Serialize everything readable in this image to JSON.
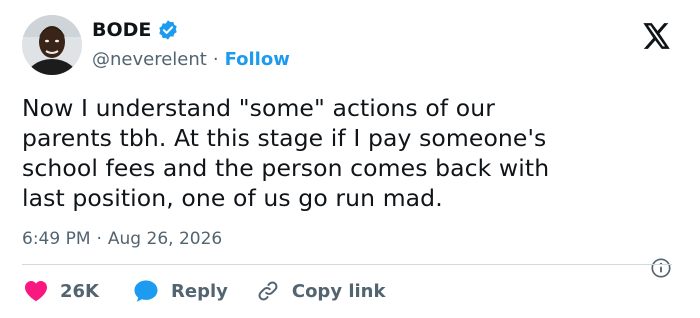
{
  "author": {
    "name": "BODE",
    "handle": "@neverelent",
    "separator": "·",
    "follow_label": "Follow",
    "avatar": "profile-photo",
    "verified": true
  },
  "brand": {
    "logo": "x-logo-icon"
  },
  "tweet": {
    "lines": [
      "Now I understand \"some\" actions of our",
      "parents tbh. At this stage if I pay someone's",
      "school fees and the person comes back with",
      "last position, one of us go run mad."
    ]
  },
  "meta": {
    "time": "6:49 PM",
    "separator": "·",
    "date": "Aug 26, 2026"
  },
  "actions": {
    "like_count": "26K",
    "reply_label": "Reply",
    "copy_label": "Copy link"
  },
  "colors": {
    "accent": "#1d9bf0",
    "like": "#f91880",
    "text": "#0f1419",
    "muted": "#536471",
    "divider": "#cfd9de"
  }
}
